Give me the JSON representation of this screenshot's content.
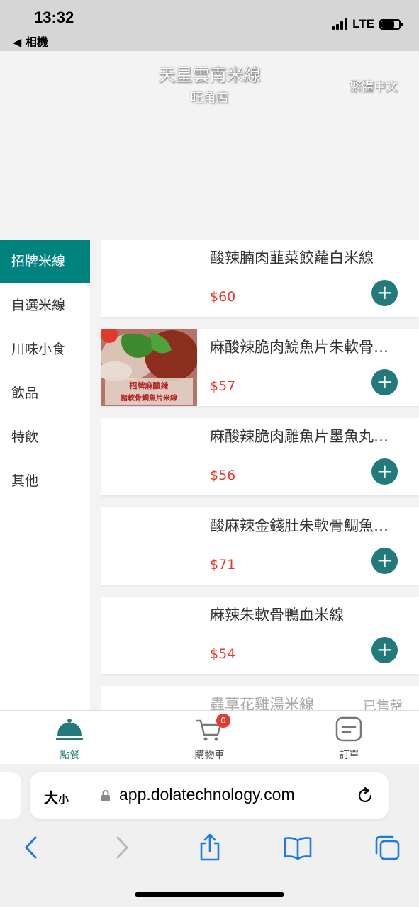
{
  "status_bar": {
    "time": "13:32",
    "back_label": "◀ 相機",
    "network": "LTE",
    "battery_level": 0.75
  },
  "header": {
    "shop_name": "天星雲南米線",
    "branch": "旺角店",
    "language": "繁體中文"
  },
  "categories": [
    {
      "label": "招牌米線",
      "active": true
    },
    {
      "label": "自選米線",
      "active": false
    },
    {
      "label": "川味小食",
      "active": false
    },
    {
      "label": "飲品",
      "active": false
    },
    {
      "label": "特飲",
      "active": false
    },
    {
      "label": "其他",
      "active": false
    }
  ],
  "menu_items": [
    {
      "name": "酸辣腩肉韮菜餃蘿白米線",
      "price": "$60",
      "has_image": false
    },
    {
      "name": "麻酸辣脆肉鯇魚片朱軟骨鯛魚米線",
      "price": "$57",
      "has_image": true,
      "image_text": [
        "招牌麻酸辣",
        "豬軟骨鯛魚片米線"
      ]
    },
    {
      "name": "麻酸辣脆肉雕魚片墨魚丸米線",
      "price": "$56",
      "has_image": false
    },
    {
      "name": "酸麻辣金錢肚朱軟骨鯛魚米線",
      "price": "$71",
      "has_image": false
    },
    {
      "name": "麻辣朱軟骨鴨血米線",
      "price": "$54",
      "has_image": false
    },
    {
      "name": "蟲草花雞湯米線",
      "price": "",
      "soldout": "已售罄"
    }
  ],
  "tabs": [
    {
      "label": "點餐",
      "icon": "cloche-icon",
      "active": true
    },
    {
      "label": "購物車",
      "icon": "cart-icon",
      "badge": "0"
    },
    {
      "label": "訂單",
      "icon": "order-icon"
    }
  ],
  "browser": {
    "text_size": "大",
    "text_size_small": "小",
    "url": "app.dolatechnology.com"
  },
  "colors": {
    "accent": "#00837f",
    "price": "#e8372c",
    "add_button": "#227a7a"
  }
}
